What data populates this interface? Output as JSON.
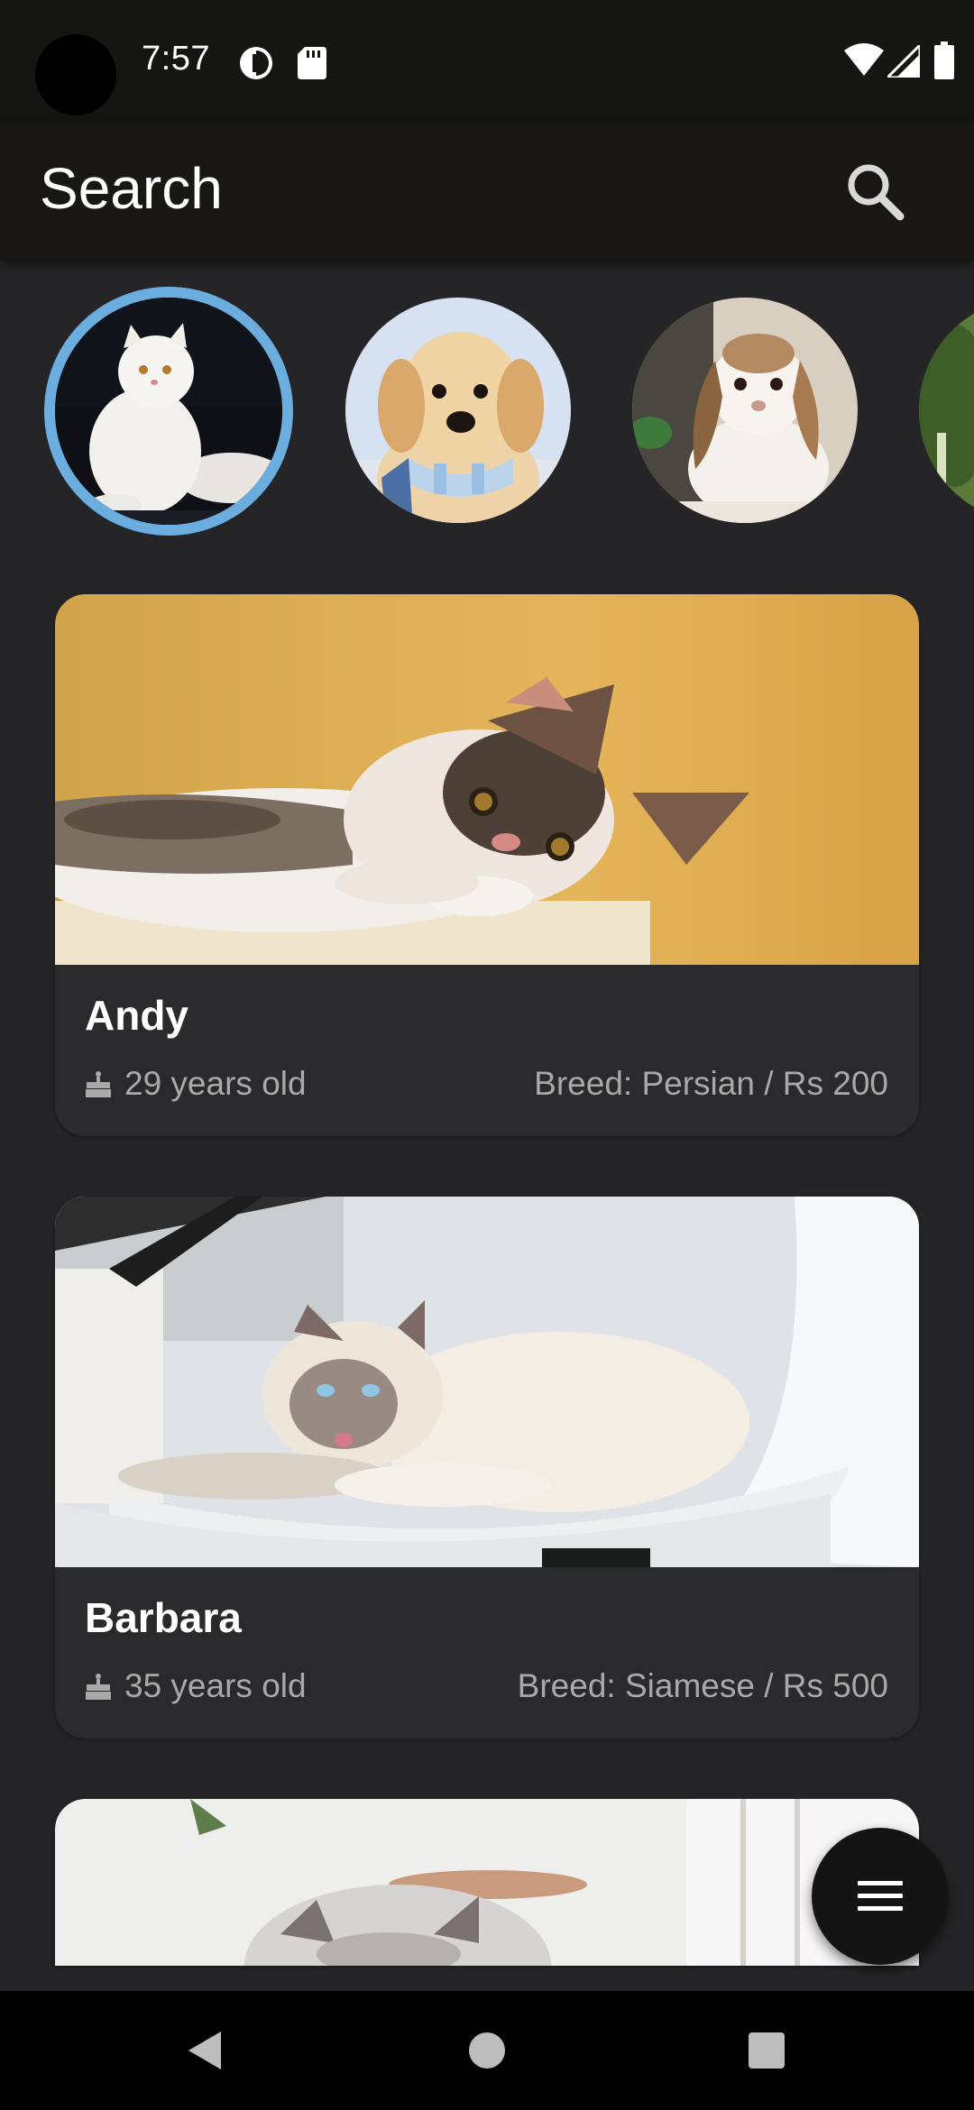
{
  "status_bar": {
    "time": "7:57",
    "icons": [
      "camera-cutout",
      "data-saver-icon",
      "sd-card-icon",
      "wifi-icon",
      "signal-icon",
      "battery-icon"
    ]
  },
  "app_bar": {
    "title": "Search",
    "search_icon": "search-icon"
  },
  "categories": [
    {
      "name": "cat-avatar",
      "selected": true
    },
    {
      "name": "dog-avatar",
      "selected": false
    },
    {
      "name": "rabbit-avatar",
      "selected": false
    },
    {
      "name": "partial-avatar",
      "selected": false
    }
  ],
  "pets": [
    {
      "name": "Andy",
      "age": "29 years old",
      "breed": "Breed: Persian / Rs 200"
    },
    {
      "name": "Barbara",
      "age": "35 years old",
      "breed": "Breed: Siamese / Rs 500"
    }
  ],
  "fab": {
    "icon": "menu-icon"
  },
  "nav_bar": {
    "icons": [
      "back-icon",
      "home-icon",
      "recents-icon"
    ]
  },
  "colors": {
    "background": "#252527",
    "app_bar": "#181713",
    "card": "#2a2a2c",
    "selected_ring": "#6cade0",
    "secondary_text": "#a9a9a9"
  }
}
